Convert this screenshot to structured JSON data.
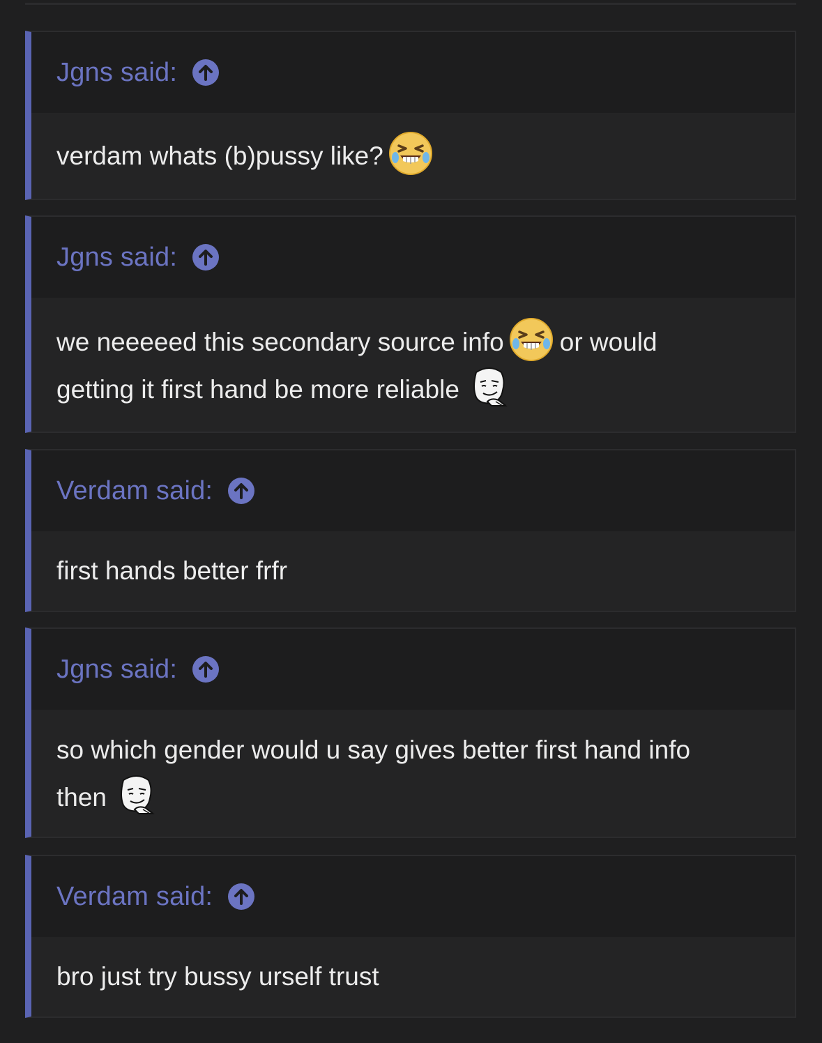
{
  "quotes": [
    {
      "author": "Jgns said:",
      "body": [
        "verdam whats (b)pussy like?"
      ],
      "emoji_after": [
        "laughing-tears-emoji"
      ]
    },
    {
      "author": "Jgns said:",
      "line1_a": "we neeeeed this secondary source info",
      "line1_b": "or would",
      "line2": "getting it first hand be more reliable",
      "emojis": [
        "laughing-tears-emoji",
        "thinking-meme-face-emoji"
      ]
    },
    {
      "author": "Verdam said:",
      "body": "first hands better frfr"
    },
    {
      "author": "Jgns said:",
      "line1": "so which gender would u say gives better first hand info",
      "line2": "then",
      "emojis": [
        "thinking-meme-face-emoji"
      ]
    },
    {
      "author": "Verdam said:",
      "body": "bro just try bussy urself trust"
    }
  ],
  "colors": {
    "background": "#1f1f20",
    "accent_bar": "#5a64b3",
    "author_text": "#6b74c2",
    "body_text": "#ececec",
    "header_bg": "#1d1d1e",
    "body_bg": "#242425"
  },
  "icons": {
    "jump_up": "arrow-up-circle-icon"
  }
}
